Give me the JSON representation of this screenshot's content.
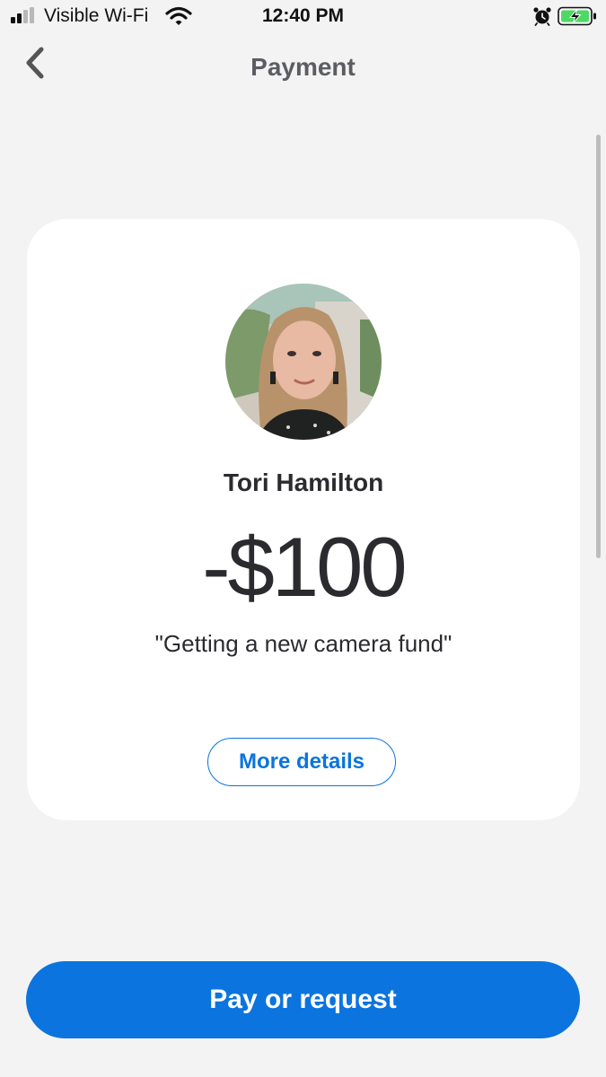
{
  "status_bar": {
    "carrier": "Visible Wi-Fi",
    "time": "12:40 PM",
    "icons": [
      "signal-icon",
      "wifi-icon",
      "alarm-icon",
      "battery-charging-icon"
    ]
  },
  "nav": {
    "title": "Payment",
    "back_icon": "chevron-left-icon"
  },
  "transaction": {
    "recipient_name": "Tori Hamilton",
    "amount": "-$100",
    "note": "\"Getting a new camera fund\"",
    "details_button": "More details"
  },
  "footer": {
    "primary_button": "Pay or request"
  },
  "colors": {
    "accent": "#0b74de",
    "background": "#f3f3f3",
    "card": "#ffffff",
    "text": "#2b2b2f",
    "battery_fill": "#4cd964"
  }
}
